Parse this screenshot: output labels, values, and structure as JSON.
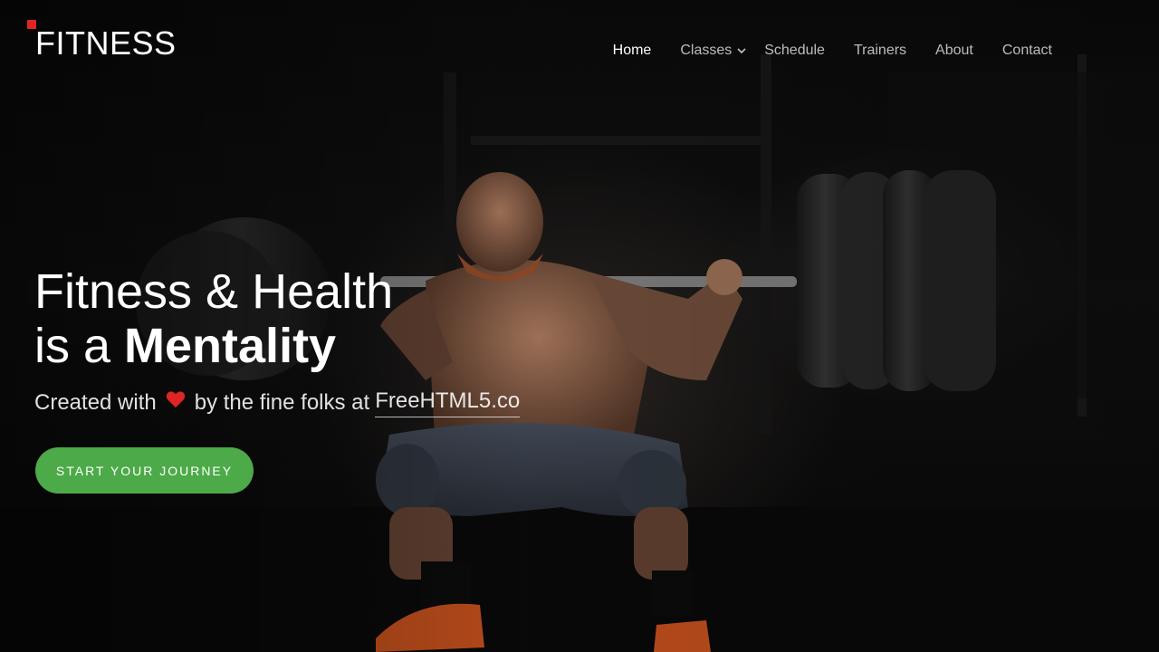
{
  "brand": {
    "logo_text": "FITNESS",
    "accent_color": "#e02424"
  },
  "nav": {
    "items": [
      {
        "label": "Home",
        "active": true
      },
      {
        "label": "Classes",
        "has_dropdown": true
      },
      {
        "label": "Schedule"
      },
      {
        "label": "Trainers"
      },
      {
        "label": "About"
      },
      {
        "label": "Contact"
      }
    ]
  },
  "hero": {
    "headline_line1": "Fitness & Health",
    "headline_line2_prefix": "is a ",
    "headline_line2_bold": "Mentality",
    "subline_prefix": "Created with",
    "subline_middle": "by the fine folks at",
    "subline_link": "FreeHTML5.co",
    "heart_icon": "heart-icon",
    "heart_color": "#e02424",
    "cta_label": "Start Your Journey",
    "cta_color": "#4caa48",
    "background_image": "athlete squatting with loaded barbell in dark gym"
  }
}
